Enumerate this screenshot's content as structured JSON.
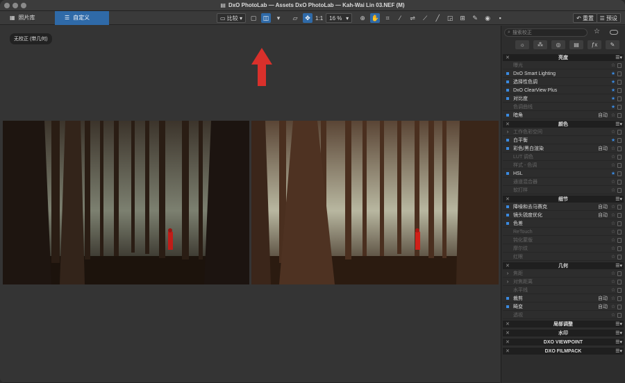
{
  "window": {
    "title": "DxO PhotoLab — Assets DxO PhotoLab — Kah-Wai Lin 03.NEF (M)"
  },
  "tabs": [
    {
      "label": "照片库"
    },
    {
      "label": "自定义"
    }
  ],
  "toolbar": {
    "compare_label": "比较",
    "one_to_one": "1:1",
    "zoom": "16 %",
    "reset_label": "重置",
    "preset_label": "预设"
  },
  "viewer": {
    "badge": "无校正 (带几何)"
  },
  "panel": {
    "search_placeholder": "搜索校正",
    "sections": [
      {
        "title": "亮度",
        "rows": [
          {
            "label": "曝光",
            "on": false,
            "auto": "",
            "fav": false
          },
          {
            "label": "DxO Smart Lighting",
            "on": true,
            "auto": "",
            "fav": true
          },
          {
            "label": "选择性色调",
            "on": true,
            "auto": "",
            "fav": true
          },
          {
            "label": "DxO ClearView Plus",
            "on": true,
            "auto": "",
            "fav": true
          },
          {
            "label": "对比度",
            "on": true,
            "auto": "",
            "fav": true
          },
          {
            "label": "色调曲线",
            "on": false,
            "auto": "",
            "fav": true
          },
          {
            "label": "暗角",
            "on": true,
            "auto": "自动",
            "fav": false
          }
        ]
      },
      {
        "title": "颜色",
        "rows": [
          {
            "label": "工作色彩空间",
            "on": false,
            "auto": "",
            "fav": false,
            "expand": true
          },
          {
            "label": "白平衡",
            "on": true,
            "auto": "",
            "fav": true
          },
          {
            "label": "彩色/黑白渲染",
            "on": true,
            "auto": "自动",
            "fav": false
          },
          {
            "label": "LUT 调色",
            "on": false,
            "auto": "",
            "fav": false
          },
          {
            "label": "样式 - 色调",
            "on": false,
            "auto": "",
            "fav": false
          },
          {
            "label": "HSL",
            "on": true,
            "auto": "",
            "fav": true
          },
          {
            "label": "通道混合器",
            "on": false,
            "auto": "",
            "fav": false
          },
          {
            "label": "软打样",
            "on": false,
            "auto": "",
            "fav": false
          }
        ]
      },
      {
        "title": "细节",
        "rows": [
          {
            "label": "降噪和去马赛克",
            "on": true,
            "auto": "自动",
            "fav": false
          },
          {
            "label": "镜头锐度优化",
            "on": true,
            "auto": "自动",
            "fav": false
          },
          {
            "label": "色差",
            "on": true,
            "auto": "",
            "fav": false
          },
          {
            "label": "ReTouch",
            "on": false,
            "auto": "",
            "fav": false
          },
          {
            "label": "钝化蒙版",
            "on": false,
            "auto": "",
            "fav": false
          },
          {
            "label": "摩尔纹",
            "on": false,
            "auto": "",
            "fav": false
          },
          {
            "label": "红眼",
            "on": false,
            "auto": "",
            "fav": false
          }
        ]
      },
      {
        "title": "几何",
        "rows": [
          {
            "label": "焦距",
            "on": false,
            "auto": "",
            "fav": false,
            "expand": true
          },
          {
            "label": "对焦距离",
            "on": false,
            "auto": "",
            "fav": false,
            "expand": true
          },
          {
            "label": "水平线",
            "on": false,
            "auto": "",
            "fav": false
          },
          {
            "label": "裁剪",
            "on": true,
            "auto": "自动",
            "fav": false
          },
          {
            "label": "畸变",
            "on": true,
            "auto": "自动",
            "fav": false
          },
          {
            "label": "透视",
            "on": false,
            "auto": "",
            "fav": false
          }
        ]
      }
    ],
    "collapsed": [
      "局部调整",
      "水印",
      "DXO VIEWPOINT",
      "DXO FILMPACK"
    ]
  }
}
